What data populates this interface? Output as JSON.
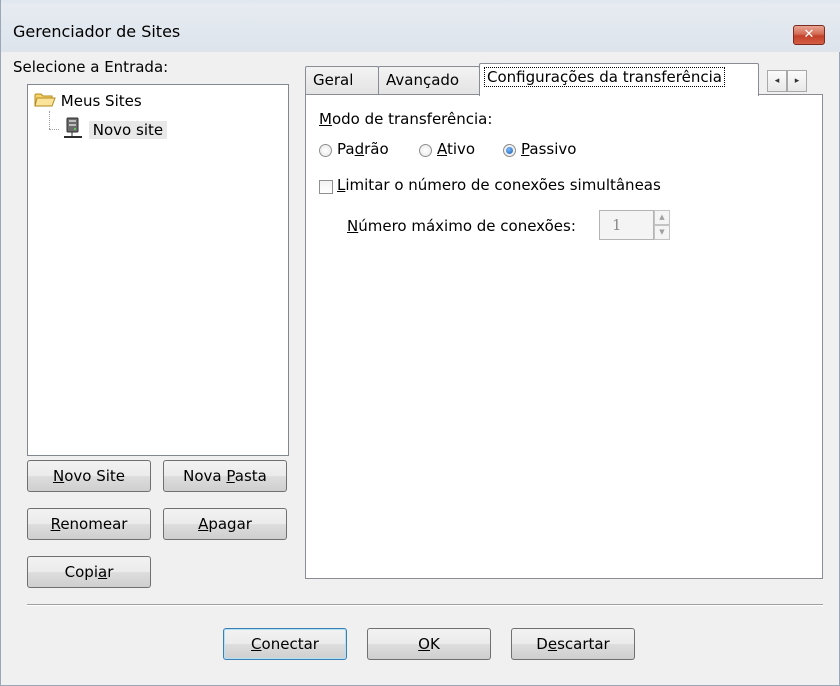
{
  "window": {
    "title": "Gerenciador de Sites",
    "close_glyph": "✕"
  },
  "left": {
    "select_label": "Selecione a Entrada:",
    "tree": {
      "root_label": "Meus Sites",
      "root_icon": "folder-icon",
      "child_label": "Novo site",
      "child_icon": "server-icon"
    },
    "buttons": {
      "new_site": {
        "pre": "",
        "key": "N",
        "post": "ovo Site"
      },
      "new_folder": {
        "pre": "Nova ",
        "key": "P",
        "post": "asta"
      },
      "rename": {
        "pre": "",
        "key": "R",
        "post": "enomear"
      },
      "delete": {
        "pre": "",
        "key": "A",
        "post": "pagar"
      },
      "copy": {
        "pre": "Copi",
        "key": "a",
        "post": "r"
      }
    }
  },
  "tabs": {
    "general": "Geral",
    "advanced": "Avançado",
    "transfer": "Configurações da transferência",
    "scroll_left": "◂",
    "scroll_right": "▸"
  },
  "transfer": {
    "mode_label": {
      "pre": "",
      "key": "M",
      "post": "odo de transferência:"
    },
    "modes": {
      "default": {
        "pre": "Pa",
        "key": "d",
        "post": "rão",
        "selected": false
      },
      "active": {
        "pre": "",
        "key": "A",
        "post": "tivo",
        "selected": false
      },
      "passive": {
        "pre": "",
        "key": "P",
        "post": "assivo",
        "selected": true
      }
    },
    "limit_label": {
      "pre": "",
      "key": "L",
      "post": "imitar o número de conexões simultâneas"
    },
    "limit_checked": false,
    "max_label": {
      "pre": "",
      "key": "N",
      "post": "úmero máximo de conexões:"
    },
    "max_value": "1"
  },
  "footer": {
    "connect": {
      "pre": "",
      "key": "C",
      "post": "onectar"
    },
    "ok": {
      "pre": "",
      "key": "O",
      "post": "K"
    },
    "discard": {
      "pre": "D",
      "key": "e",
      "post": "scartar"
    }
  },
  "colors": {
    "window_bg": "#f0f0f0",
    "close_red": "#c2402a",
    "radio_blue": "#1c5fb0"
  }
}
